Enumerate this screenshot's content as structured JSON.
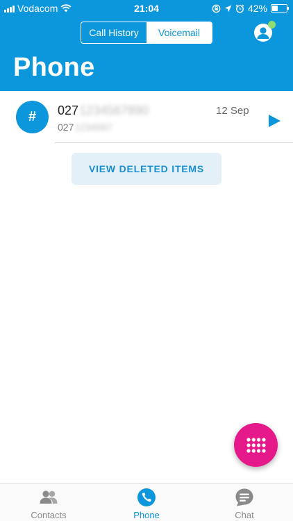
{
  "status_bar": {
    "carrier": "Vodacom",
    "time": "21:04",
    "battery": "42%",
    "battery_level": 0.42
  },
  "header": {
    "segments": [
      {
        "label": "Call History",
        "active": false
      },
      {
        "label": "Voicemail",
        "active": true
      }
    ],
    "title": "Phone"
  },
  "voicemails": [
    {
      "avatar_glyph": "#",
      "number_prefix": "027",
      "number_redacted": "1234567890",
      "sub_prefix": "027",
      "sub_redacted": "1234567",
      "date": "12 Sep"
    }
  ],
  "view_deleted_label": "VIEW DELETED ITEMS",
  "tabs": [
    {
      "label": "Contacts",
      "icon": "contacts-icon",
      "selected": false
    },
    {
      "label": "Phone",
      "icon": "phone-icon",
      "selected": true
    },
    {
      "label": "Chat",
      "icon": "chat-icon",
      "selected": false
    }
  ],
  "colors": {
    "brand": "#0c96dc",
    "fab": "#e5198a",
    "presence": "#8fdc6f"
  }
}
